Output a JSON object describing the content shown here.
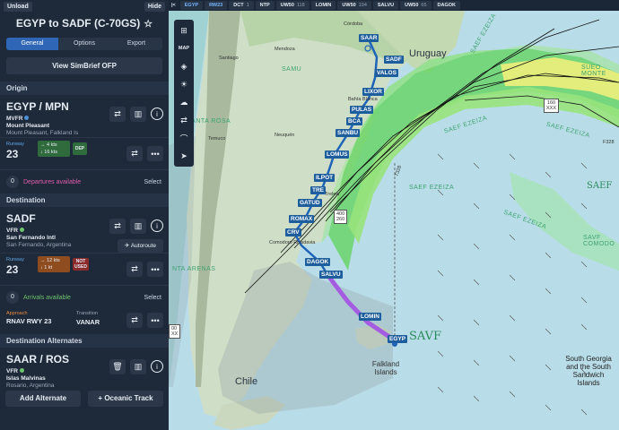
{
  "panel": {
    "unload_label": "Unload",
    "hide_label": "Hide",
    "flight_title": "EGYP to SADF (C-70GS)",
    "star_glyph": "☆",
    "tabs": [
      {
        "label": "General",
        "active": true
      },
      {
        "label": "Options",
        "active": false
      },
      {
        "label": "Export",
        "active": false
      }
    ],
    "simbrief_label": "View SimBrief OFP"
  },
  "origin": {
    "section": "Origin",
    "code": "EGYP / MPN",
    "rules": "MVFR",
    "name": "Mount Pleasant",
    "location": "Mount Pleasant, Falkland Is",
    "runway_label": "Runway",
    "runway": "23",
    "wind_head": "4 kts",
    "wind_cross": "16 kts",
    "badge": "DEP",
    "proc_count": "0",
    "proc_text": "Departures available",
    "select_label": "Select"
  },
  "destination": {
    "section": "Destination",
    "code": "SADF",
    "rules": "VFR",
    "name": "San Fernando Intl",
    "location": "San Fernando, Argentina",
    "autoroute_label": "Autoroute",
    "runway_label": "Runway",
    "runway": "23",
    "wind_head": "12 kts",
    "wind_cross": "1 kt",
    "badge": "NOT USED",
    "proc_count": "0",
    "proc_text": "Arrivals available",
    "select_label": "Select",
    "approach_label": "Approach",
    "approach": "RNAV RWY 23",
    "transition_label": "Transition",
    "transition": "VANAR"
  },
  "alternates": {
    "section": "Destination Alternates",
    "code": "SAAR / ROS",
    "rules": "VFR",
    "name": "Islas Malvinas",
    "location": "Rosario, Argentina",
    "add_alternate_label": "Add Alternate",
    "oceanic_label": "+ Oceanic Track"
  },
  "strip": [
    {
      "name": "EGYP",
      "num": "",
      "hl": true
    },
    {
      "name": "RW23",
      "num": "",
      "hl": true
    },
    {
      "name": "DCT",
      "num": "1",
      "hl": false
    },
    {
      "name": "NTP",
      "num": "",
      "hl": false
    },
    {
      "name": "UW50",
      "num": "118",
      "hl": false
    },
    {
      "name": "LOMIN",
      "num": "",
      "hl": false
    },
    {
      "name": "UW50",
      "num": "194",
      "hl": false
    },
    {
      "name": "SALVU",
      "num": "",
      "hl": false
    },
    {
      "name": "UW50",
      "num": "65",
      "hl": false
    },
    {
      "name": "DAGOK",
      "num": "",
      "hl": false
    }
  ],
  "tools": {
    "map_label": "MAP"
  },
  "map": {
    "fixes": [
      "SAAR",
      "SADF",
      "VALOS",
      "LIXOR",
      "PULAS",
      "BCA",
      "SANBU",
      "LOMUS",
      "ILPOT",
      "TRE",
      "GATUD",
      "ROMAX",
      "CRV",
      "DAGOK",
      "SALVU",
      "LOMIN",
      "EGYP"
    ],
    "places": {
      "uruguay": "Uruguay",
      "chile": "Chile",
      "falkland": "Falkland Islands",
      "south_georgia": "South Georgia and the South Sandwich Islands",
      "savf": "SAVF",
      "saef": "SAEF",
      "saef_ezeiza_1": "SAEF EZEIZA",
      "saef_ezeiza_2": "SAEF EZEIZA",
      "saef_ezeiza_3": "SAEF EZEIZA",
      "saef_ezeiza_4": "SAEF EZEIZA",
      "saef_ezeiza_5": "SAEF EZEIZA",
      "savf_comodoro": "SAVF COMODO",
      "sueo_monte": "SUEO MONTE",
      "comodoro": "Comodoro Rivadavia",
      "santa_rosa": "SANTA ROSA",
      "punta_arenas": "NTA ARENAS",
      "mendoza": "Mendoza",
      "cordoba": "Córdoba",
      "neuquen": "Neuquén",
      "bahia": "Bahía Blanca",
      "santiago": "Santiago",
      "temuco": "Temuco",
      "trelew": "Trelew",
      "samu": "SAMU",
      "airway_1": "T328",
      "airway_2": "F328",
      "alt_label_1": "400",
      "alt_label_2": "260",
      "alt_label_3": "160",
      "alt_label_4": "XXX",
      "alt_label_5": "00",
      "alt_label_6": "XX"
    }
  }
}
